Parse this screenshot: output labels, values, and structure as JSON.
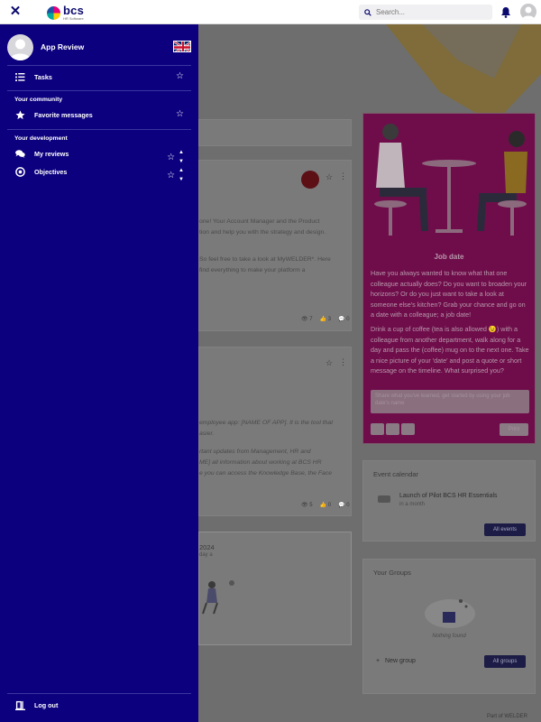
{
  "topbar": {
    "logo_word": "bcs",
    "logo_sub": "HR Software",
    "search_placeholder": "Search..."
  },
  "sidebar": {
    "profile_name": "App Review",
    "items": {
      "tasks": "Tasks",
      "favorite_messages": "Favorite messages",
      "my_reviews": "My reviews",
      "objectives": "Objectives",
      "log_out": "Log out"
    },
    "sections": {
      "community": "Your community",
      "development": "Your development"
    }
  },
  "background": {
    "post1": {
      "line1": "one! Your Account Manager and the Product",
      "line2": "tion and help you with the strategy and design.",
      "line3": "So feel free to take a look at MyWELDER*. Here",
      "line4": "find everything to make your platform a",
      "views": "7",
      "likes": "3",
      "comments": "0"
    },
    "post2": {
      "line1": "employee app: [NAME OF APP]. It is the tool that",
      "line2": "asier.",
      "line3": "rtant updates from Management, HR and",
      "line4": "ME] all information about working at BCS HR",
      "line5": "e you can access the Knowledge Base, the Face",
      "views": "5",
      "likes": "0",
      "comments": "0"
    },
    "post3": {
      "year": "2024",
      "sub": "day a"
    },
    "job_date": {
      "title": "Job date",
      "p1": "Have you always wanted to know what that one colleague actually does? Do you want to broaden your horizons? Or do you just want to take a look at someone else's kitchen? Grab your chance and go on a date with a colleague; a job date!",
      "p2": "Drink a cup of coffee (tea is also allowed 😉) with a colleague from another department, walk along for a day and pass the (coffee) mug on to the next one. Take a nice picture of your 'date' and post a quote or short message on the timeline. What surprised you?",
      "input_placeholder": "Share what you've learned, get started by using your job date's name",
      "print_label": "Print"
    },
    "event_calendar": {
      "title": "Event calendar",
      "event_title": "Launch of Pilot BCS HR Essentials",
      "event_time": "in a month",
      "all_events": "All events"
    },
    "groups": {
      "title": "Your Groups",
      "empty": "Nothing found",
      "new_group": "New group",
      "all_groups": "All groups"
    },
    "footer": "Part of WELDER"
  },
  "colors": {
    "sidebar_bg": "#0c007e",
    "job_date_bg": "#6f0d4b",
    "brand_dark": "#0a0a6e"
  }
}
